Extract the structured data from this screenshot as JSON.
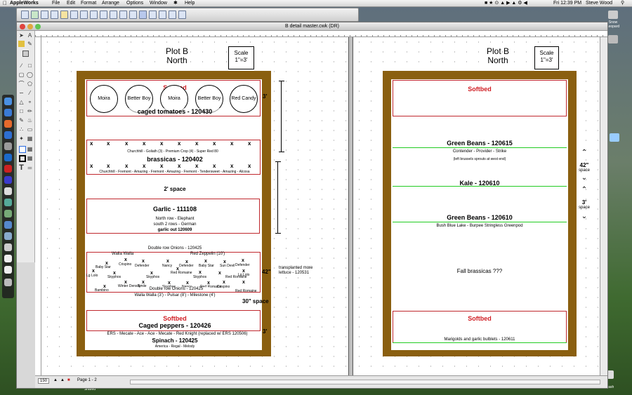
{
  "menubar": {
    "app": "AppleWorks",
    "items": [
      "File",
      "Edit",
      "Format",
      "Arrange",
      "Options",
      "Window",
      "Help"
    ],
    "clock": "Fri 12:39 PM",
    "user": "Steve Wood"
  },
  "desktop": {
    "icons": [
      "Snow Leopard",
      "Trash",
      "Shared"
    ]
  },
  "window": {
    "title": "B detail master.cwk (DR)"
  },
  "status": {
    "zoom": "150",
    "page": "Page 1 - 2"
  },
  "left_page": {
    "title": "Plot B",
    "subtitle": "North",
    "scale_label": "Scale",
    "scale_value": "1\"=3'",
    "softbed_top": "Softbed",
    "circles": [
      "Moira",
      "Better Boy",
      "Moira",
      "Better Boy",
      "Red Candy"
    ],
    "tomatoes": "caged tomatoes - 120430",
    "dim_3ft_a": "3'",
    "brassicas_varieties_top": "Churchhill - Goliath (3) - Premium Crop (4) - Super Red 80",
    "brassicas": "brassicas - 120402",
    "brassicas_varieties_bottom": "Churchhill - Fremont - Amazing - Fremont - Amazing - Fremont - Tendersweet - Amazing - Alcosa",
    "space_2ft": "2' space",
    "garlic": "Garlic - 111108",
    "garlic_north": "North row - Elephant",
    "garlic_south": "south 2 rows - German",
    "garlic_out": "garlic out 120609",
    "onions": "Double row Onions - 120425",
    "walla_walla": "Walla Walla",
    "red_zeppelin": "Red Zeppelin (10')",
    "lettuce_names": [
      "Baby Star",
      "Crispino",
      "Defender",
      "Nancy",
      "Defender",
      "Baby Star",
      "Sun Devil",
      "Defender",
      "Lg Lolo",
      "Skyphos",
      "Red Romaine",
      "Skyphos",
      "Lg Lolo",
      "Skyphos",
      "Red Romaine",
      "Winter Density",
      "Smile",
      "Skyphos",
      "Nancy",
      "Red Romaine",
      "Crispino",
      "Bambino",
      "Red Romaine"
    ],
    "dim_42": "42\"",
    "transplant_note": "transplanted more lettuce - 120531",
    "onions_double": "Double row Onions - 120425",
    "onions_bottom": "Walla Walla (3') - Pulsar (8') - Milestone (4')",
    "space_30": "30\" space",
    "softbed_bottom": "Softbed",
    "peppers": "Caged peppers - 120426",
    "dim_3ft_b": "3'",
    "peppers_varieties": "ERS - Mecate - Ace - Ace - Mecate - Red Knight (replaced w/ ERS 120506)",
    "spinach": "Spinach - 120425",
    "spinach_varieties": "America - Regal - Melody"
  },
  "right_page": {
    "title": "Plot B",
    "subtitle": "North",
    "scale_label": "Scale",
    "scale_value": "1\"=3'",
    "softbed_top": "Softbed",
    "green_beans_1": "Green Beans - 120615",
    "gb1_varieties": "Contender - Provider - Strike",
    "gb1_note": "(left brussels sprouts at west end)",
    "kale": "Kale - 120610",
    "green_beans_2": "Green Beans - 120610",
    "gb2_varieties": "Bush Blue Lake  -  Burpee Stringless Greenpod",
    "fall_brassicas": "Fall brassicas ???",
    "softbed_bottom": "Softbed",
    "marigolds": "Marigolds and garlic bulblets - 120611",
    "dim_42": "42\"",
    "dim_42_sub": "space",
    "dim_3ft": "3'",
    "dim_3ft_sub": "space"
  },
  "colors": {
    "frame": "#8a5f10",
    "bed_border": "#c0282e",
    "softbed": "#d01e24",
    "row_line": "#22cc22"
  }
}
